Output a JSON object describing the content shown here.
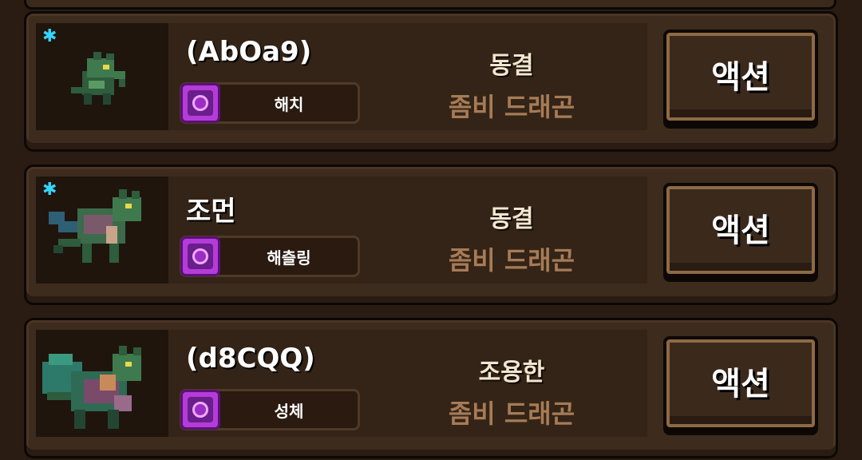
{
  "cards": [
    {
      "frozen_icon": "snowflake-icon",
      "name": "(AbOa9)",
      "stage": "해치",
      "status": "동결",
      "species": "좀비 드래곤",
      "action": "액션"
    },
    {
      "frozen_icon": "snowflake-icon",
      "name": "조먼",
      "stage": "해츨링",
      "status": "동결",
      "species": "좀비 드래곤",
      "action": "액션"
    },
    {
      "name": "(d8CQQ)",
      "stage": "성체",
      "status": "조용한",
      "species": "좀비 드래곤",
      "action": "액션"
    }
  ],
  "colors": {
    "frost": "#33d6ff",
    "gem": "#b43cd8",
    "species_text": "#a77b56"
  }
}
